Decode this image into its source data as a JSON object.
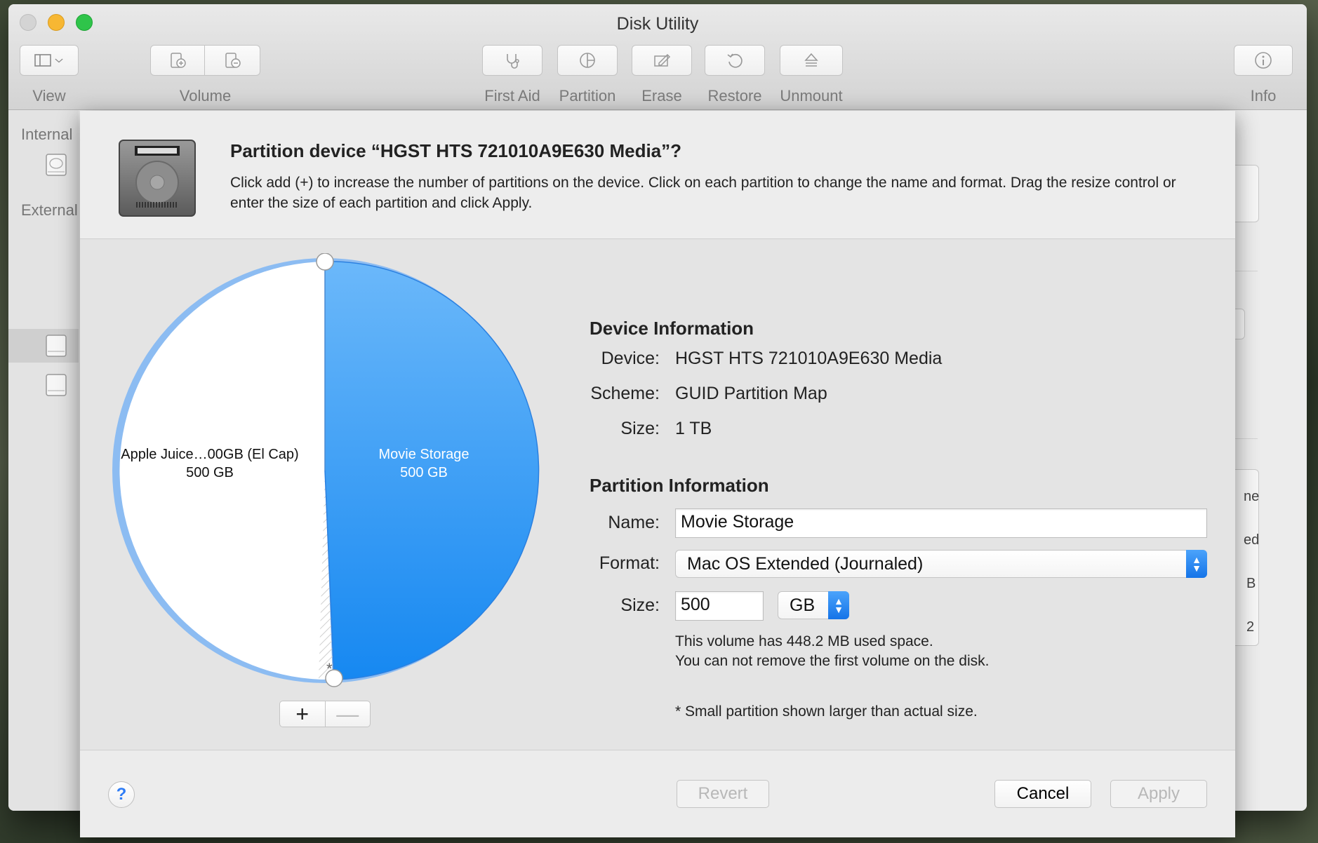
{
  "window": {
    "title": "Disk Utility"
  },
  "toolbar": {
    "view_label": "View",
    "volume_label": "Volume",
    "first_aid_label": "First Aid",
    "partition_label": "Partition",
    "erase_label": "Erase",
    "restore_label": "Restore",
    "unmount_label": "Unmount",
    "info_label": "Info"
  },
  "sidebar": {
    "internal_label": "Internal",
    "external_label": "External"
  },
  "background_pane": {
    "partial_labels": [
      "ne",
      "ed",
      "B",
      "2"
    ]
  },
  "sheet": {
    "title": "Partition device “HGST HTS 721010A9E630 Media”?",
    "description": "Click add (+) to increase the number of partitions on the device. Click on each partition to change the name and format. Drag the resize control or enter the size of each partition and click Apply."
  },
  "pie": {
    "partitions": [
      {
        "name": "Apple Juice…00GB (El Cap)",
        "size": "500 GB",
        "color": "#ffffff"
      },
      {
        "name": "Movie Storage",
        "size": "500 GB",
        "color": "#2f95f3",
        "selected": true
      }
    ],
    "small_partition_marker": "*"
  },
  "device_info": {
    "heading": "Device Information",
    "device_label": "Device:",
    "device_value": "HGST HTS 721010A9E630 Media",
    "scheme_label": "Scheme:",
    "scheme_value": "GUID Partition Map",
    "size_label": "Size:",
    "size_value": "1 TB"
  },
  "partition_info": {
    "heading": "Partition Information",
    "name_label": "Name:",
    "name_value": "Movie Storage",
    "format_label": "Format:",
    "format_value": "Mac OS Extended (Journaled)",
    "size_label": "Size:",
    "size_value": "500",
    "unit_value": "GB",
    "note_line1": "This volume has 448.2 MB used space.",
    "note_line2": "You can not remove the first volume on the disk.",
    "footnote": "* Small partition shown larger than actual size."
  },
  "buttons": {
    "add": "+",
    "remove": "—",
    "help": "?",
    "revert": "Revert",
    "cancel": "Cancel",
    "apply": "Apply"
  },
  "colors": {
    "accent": "#1f7cf0",
    "partition_blue": "#2f95f3",
    "ring": "#8cbcf2"
  }
}
